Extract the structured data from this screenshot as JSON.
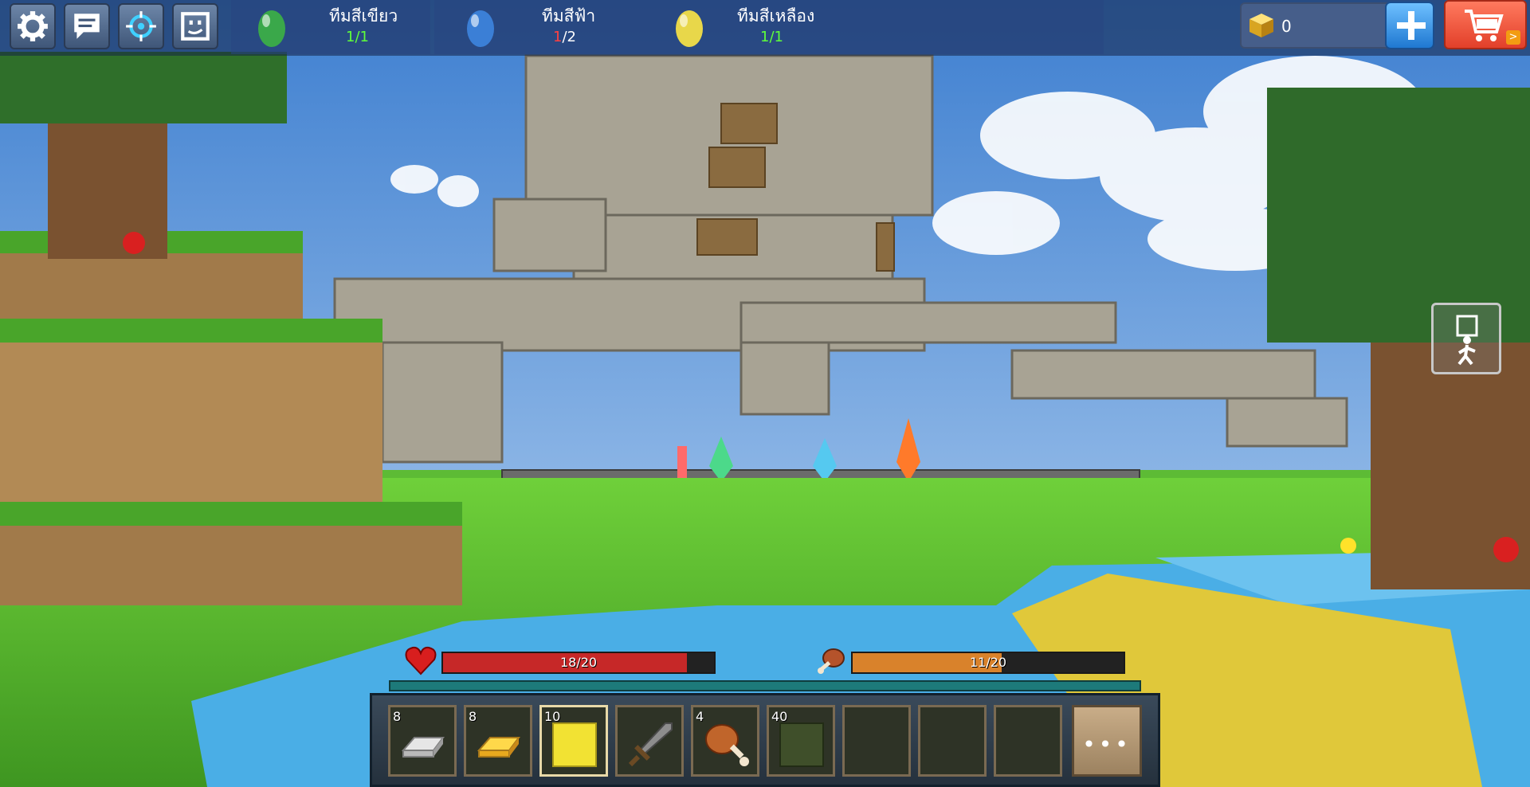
{
  "top_bar": {
    "buttons": [
      {
        "name": "settings",
        "icon": "gear-icon"
      },
      {
        "name": "chat",
        "icon": "chat-bubble-icon"
      },
      {
        "name": "target",
        "icon": "crosshair-icon"
      },
      {
        "name": "emote",
        "icon": "emote-face-icon"
      }
    ],
    "teams": [
      {
        "name": "ทีมสีเขียว",
        "current": "1",
        "total": "/1",
        "egg_color": "#3aa84a",
        "current_color": "#5fff3a"
      },
      {
        "name": "ทีมสีฟ้า",
        "current": "1",
        "total": "/2",
        "egg_color": "#3b7fd6",
        "current_color": "#ff4040"
      },
      {
        "name": "ทีมสีเหลือง",
        "current": "1",
        "total": "/1",
        "egg_color": "#e8d74a",
        "current_color": "#5fff3a"
      }
    ],
    "currency": {
      "icon": "gold-cube-icon",
      "amount": "0"
    },
    "add_currency_icon": "plus-icon",
    "shop_icon": "shopping-cart-icon",
    "shop_arrow": ">"
  },
  "perspective_button": {
    "icon": "person-walk-icon"
  },
  "status": {
    "health": {
      "label": "18/20",
      "value": 18,
      "max": 20,
      "color": "#c62828",
      "icon": "heart-icon"
    },
    "hunger": {
      "label": "11/20",
      "value": 11,
      "max": 20,
      "color": "#d9822b",
      "icon": "meat-icon"
    }
  },
  "hotbar": {
    "slots": [
      {
        "count": "8",
        "item": "iron-ingot-icon"
      },
      {
        "count": "8",
        "item": "gold-ingot-icon"
      },
      {
        "count": "10",
        "item": "yellow-wool-block-icon",
        "selected": true
      },
      {
        "count": "",
        "item": "stone-sword-icon"
      },
      {
        "count": "4",
        "item": "chicken-leg-icon"
      },
      {
        "count": "40",
        "item": "mossy-block-icon"
      },
      {
        "count": "",
        "item": "empty-slot"
      },
      {
        "count": "",
        "item": "empty-slot"
      },
      {
        "count": "",
        "item": "empty-slot"
      }
    ],
    "more_label": "•••"
  }
}
